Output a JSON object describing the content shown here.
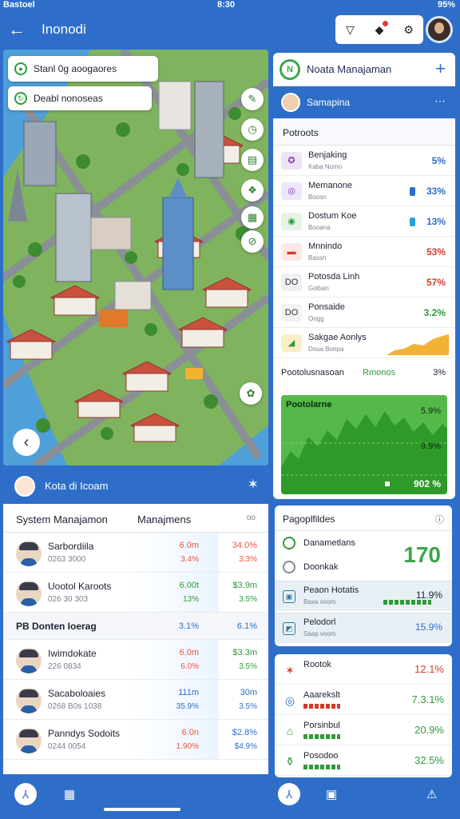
{
  "status": {
    "left": "Bastoel",
    "time": "8:30",
    "right": "95%"
  },
  "appbar": {
    "title": "Inonodi",
    "back_glyph": "←"
  },
  "map": {
    "chip1": "Stanl 0g aoogaores",
    "chip2": "Deabl nonoseas"
  },
  "panel_right": {
    "title": "Noata Manajaman",
    "user": "Samapina",
    "section": "Potroots",
    "rows": [
      {
        "t1": "Benjaking",
        "t2": "Kaba Nomo",
        "pct": "5%",
        "color": "#2e6ec9"
      },
      {
        "t1": "Memanone",
        "t2": "Boosn",
        "pct": "33%",
        "color": "#2e6ec9"
      },
      {
        "t1": "Dostum Koe",
        "t2": "Booana",
        "pct": "13%",
        "color": "#2e6ec9"
      },
      {
        "t1": "Mnnindo",
        "t2": "Bassn",
        "pct": "53%",
        "color": "#d23b2a"
      },
      {
        "t1": "Potosda Linh",
        "t2": "Gottain",
        "pct": "57%",
        "color": "#d23b2a"
      },
      {
        "t1": "Ponsaide",
        "t2": "Oogg",
        "pct": "3.2%",
        "color": "#2e9b3a"
      },
      {
        "t1": "Sakgae Aonlys",
        "t2": "Doua Bonpa",
        "pct": "",
        "color": "#2e9b3a"
      }
    ],
    "sub": {
      "a": "Pootolusnasoan",
      "b": "Rmonos",
      "c": "3%"
    },
    "chart_title": "Pootolarne",
    "chart_v1": "5.9%",
    "chart_v2": "9.9%",
    "chart_v3": "902 %"
  },
  "panel_left": {
    "title": "Kota di Icoam",
    "tab_a": "System Manajamon",
    "tab_b": "Manajmens",
    "tab_c": "oo",
    "rows": [
      {
        "n1": "Sarbordiila",
        "n2": "0263 3000",
        "c1": "6.0m",
        "c2": "3.4%",
        "c3": "34.0%",
        "c4": "3.3%",
        "col1": "#e8553e",
        "col3": "#e8553e"
      },
      {
        "n1": "Uootol Karoots",
        "n2": "026 30 303",
        "c1": "6.00t",
        "c2": "13%",
        "c3": "$3.9m",
        "c4": "3.5%",
        "col1": "#2e9b3a",
        "col3": "#2e9b3a"
      },
      {
        "n1": "Iwimdokate",
        "n2": "226 0834",
        "c1": "6.0m",
        "c2": "6.0%",
        "c3": "$3.3m",
        "c4": "3.5%",
        "col1": "#e8553e",
        "col3": "#2e9b3a"
      },
      {
        "n1": "Sacaboloaies",
        "n2": "0268 B0s 1038",
        "c1": "111m",
        "c2": "35.9%",
        "c3": "30m",
        "c4": "3.5%",
        "col1": "#2e6ec9",
        "col3": "#2e6ec9"
      },
      {
        "n1": "Panndys Sodoits",
        "n2": "0244 0054",
        "c1": "6.0n",
        "c2": "1.90%",
        "c3": "$2.8%",
        "c4": "$4.9%",
        "col1": "#e8553e",
        "col3": "#2e6ec9"
      }
    ],
    "divider": {
      "n": "PB Donten Ioerag",
      "c1": "3.1%",
      "c3": "6.1%"
    }
  },
  "panel_mid": {
    "title": "Pagoplfildes",
    "r1": "Danametlans",
    "r2": "Doonkak",
    "big": "170",
    "rows": [
      {
        "t1": "Peaon Hotatis",
        "t2": "Baxa ooom",
        "v": "11.9%"
      },
      {
        "t1": "Pelodorl",
        "t2": "Saap voom",
        "v": "15.9%"
      }
    ]
  },
  "panel_bottom": {
    "rows": [
      {
        "t": "Rootok",
        "v": "12.1%",
        "color": "#d23b2a"
      },
      {
        "t": "Aaarekslt",
        "v": "7.3.1%",
        "color": "#2e9b3a"
      },
      {
        "t": "Porsinbul",
        "v": "20.9%",
        "color": "#2e9b3a"
      },
      {
        "t": "Posodoo",
        "v": "32.5%",
        "color": "#2e9b3a"
      }
    ]
  },
  "colors": {
    "brand": "#2e6ec9",
    "accent_green": "#3aa84a",
    "accent_red": "#d23b2a"
  }
}
